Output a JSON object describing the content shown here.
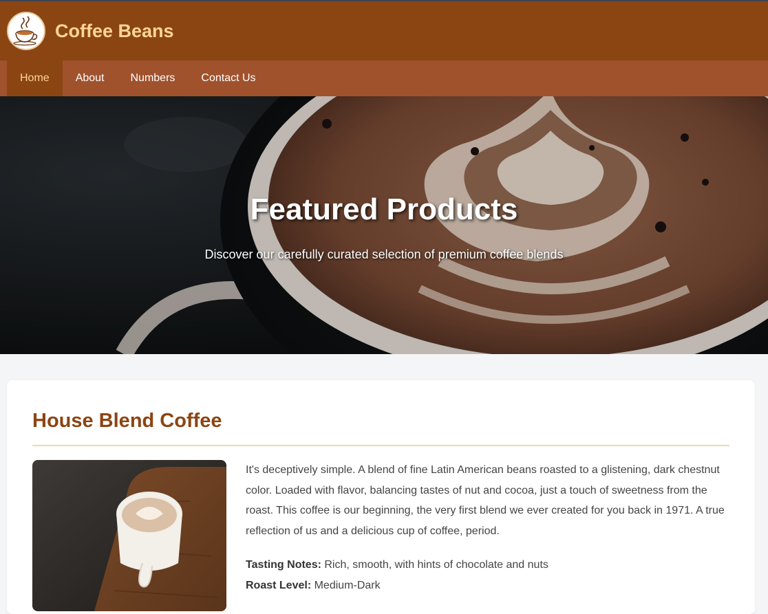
{
  "header": {
    "site_title": "Coffee Beans",
    "logo_icon": "coffee-cup-logo"
  },
  "nav": {
    "items": [
      {
        "label": "Home",
        "active": true
      },
      {
        "label": "About",
        "active": false
      },
      {
        "label": "Numbers",
        "active": false
      },
      {
        "label": "Contact Us",
        "active": false
      }
    ]
  },
  "hero": {
    "title": "Featured Products",
    "subtitle": "Discover our carefully curated selection of premium coffee blends"
  },
  "product": {
    "title": "House Blend Coffee",
    "description": "It's deceptively simple. A blend of fine Latin American beans roasted to a glistening, dark chestnut color. Loaded with flavor, balancing tastes of nut and cocoa, just a touch of sweetness from the roast. This coffee is our beginning, the very first blend we ever created for you back in 1971. A true reflection of us and a delicious cup of coffee, period.",
    "tasting_notes_label": "Tasting Notes:",
    "tasting_notes": "Rich, smooth, with hints of chocolate and nuts",
    "roast_level_label": "Roast Level:",
    "roast_level": "Medium-Dark"
  },
  "colors": {
    "header_bg": "#8b4513",
    "nav_bg": "#a0522d",
    "accent": "#ffd59a",
    "title_brown": "#8b4513"
  }
}
